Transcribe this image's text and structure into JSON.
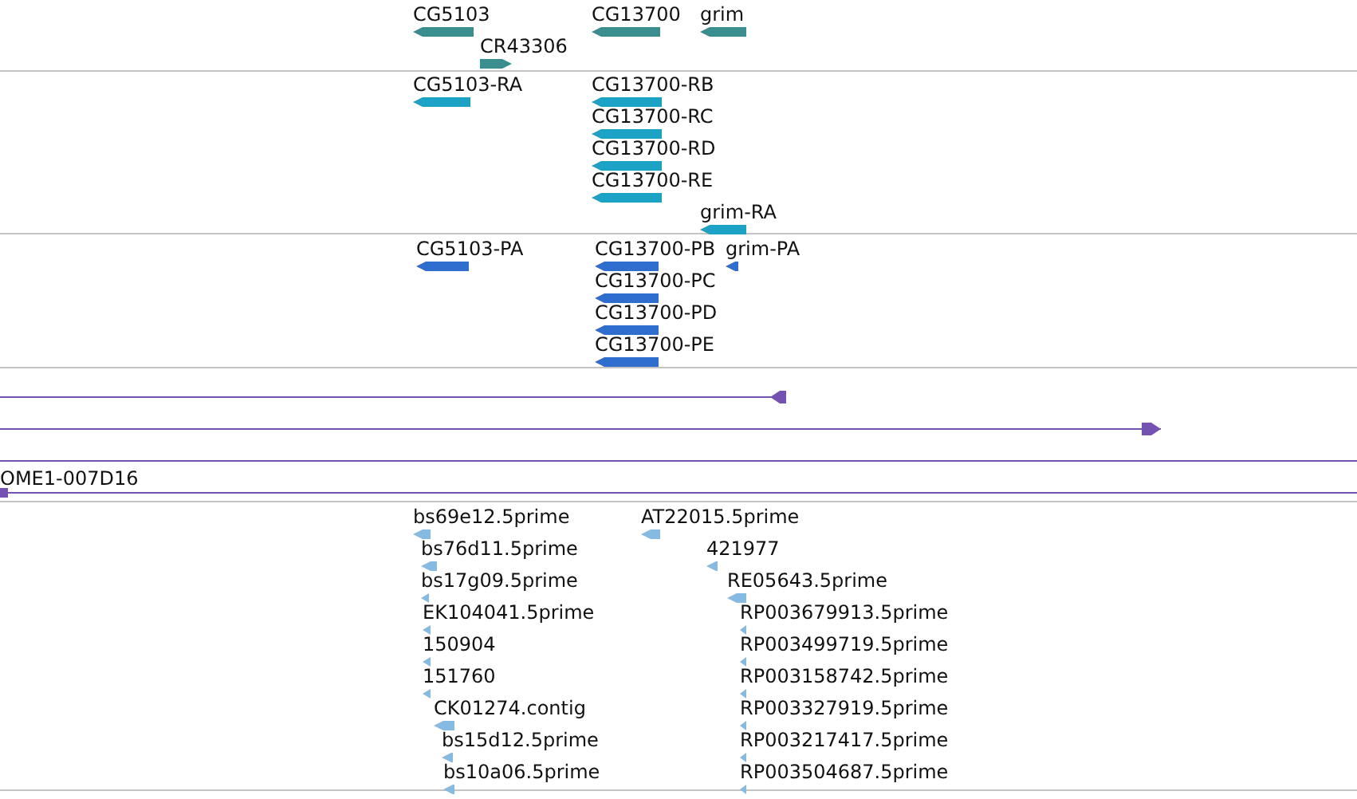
{
  "tracks": [
    {
      "kind": "bars",
      "color": "#3a8e8e",
      "features": [
        {
          "label": "CG5103",
          "kind": "reverse"
        },
        {
          "label": "CR43306",
          "kind": "forward"
        },
        {
          "label": "CG13700",
          "kind": "reverse"
        },
        {
          "label": "grim",
          "kind": "reverse"
        }
      ]
    },
    {
      "kind": "bars",
      "color": "#1ba2c4",
      "features": [
        {
          "label": "CG5103-RA",
          "kind": "reverse"
        },
        {
          "label": "CG13700-RB",
          "kind": "reverse"
        },
        {
          "label": "CG13700-RC",
          "kind": "reverse"
        },
        {
          "label": "CG13700-RD",
          "kind": "reverse"
        },
        {
          "label": "CG13700-RE",
          "kind": "reverse"
        },
        {
          "label": "grim-RA",
          "kind": "reverse"
        }
      ]
    },
    {
      "kind": "bars",
      "color": "#2f6ecf",
      "features": [
        {
          "label": "CG5103-PA",
          "kind": "reverse"
        },
        {
          "label": "CG13700-PB",
          "kind": "reverse"
        },
        {
          "label": "grim-PA",
          "kind": "reverse"
        },
        {
          "label": "CG13700-PC",
          "kind": "reverse"
        },
        {
          "label": "CG13700-PD",
          "kind": "reverse"
        },
        {
          "label": "CG13700-PE",
          "kind": "reverse"
        }
      ]
    },
    {
      "kind": "lines",
      "color": "#7452b2",
      "features": [
        {
          "kind": "reverse"
        },
        {
          "kind": "forward"
        },
        {
          "kind": "plain"
        },
        {
          "label": "OME1-007D16",
          "kind": "block"
        }
      ]
    },
    {
      "kind": "bars",
      "color": "#85bbe3",
      "features": [
        {
          "label": "bs69e12.5prime",
          "kind": "reverse"
        },
        {
          "label": "AT22015.5prime",
          "kind": "reverse"
        },
        {
          "label": "bs76d11.5prime",
          "kind": "reverse"
        },
        {
          "label": "421977",
          "kind": "reverse"
        },
        {
          "label": "bs17g09.5prime",
          "kind": "reverse"
        },
        {
          "label": "RE05643.5prime",
          "kind": "reverse"
        },
        {
          "label": "EK104041.5prime",
          "kind": "reverse"
        },
        {
          "label": "RP003679913.5prime",
          "kind": "reverse"
        },
        {
          "label": "150904",
          "kind": "reverse"
        },
        {
          "label": "RP003499719.5prime",
          "kind": "reverse"
        },
        {
          "label": "151760",
          "kind": "reverse"
        },
        {
          "label": "RP003158742.5prime",
          "kind": "reverse"
        },
        {
          "label": "CK01274.contig",
          "kind": "reverse"
        },
        {
          "label": "RP003327919.5prime",
          "kind": "reverse"
        },
        {
          "label": "bs15d12.5prime",
          "kind": "reverse"
        },
        {
          "label": "RP003217417.5prime",
          "kind": "reverse"
        },
        {
          "label": "bs10a06.5prime",
          "kind": "reverse"
        },
        {
          "label": "RP003504687.5prime",
          "kind": "reverse"
        }
      ]
    }
  ]
}
